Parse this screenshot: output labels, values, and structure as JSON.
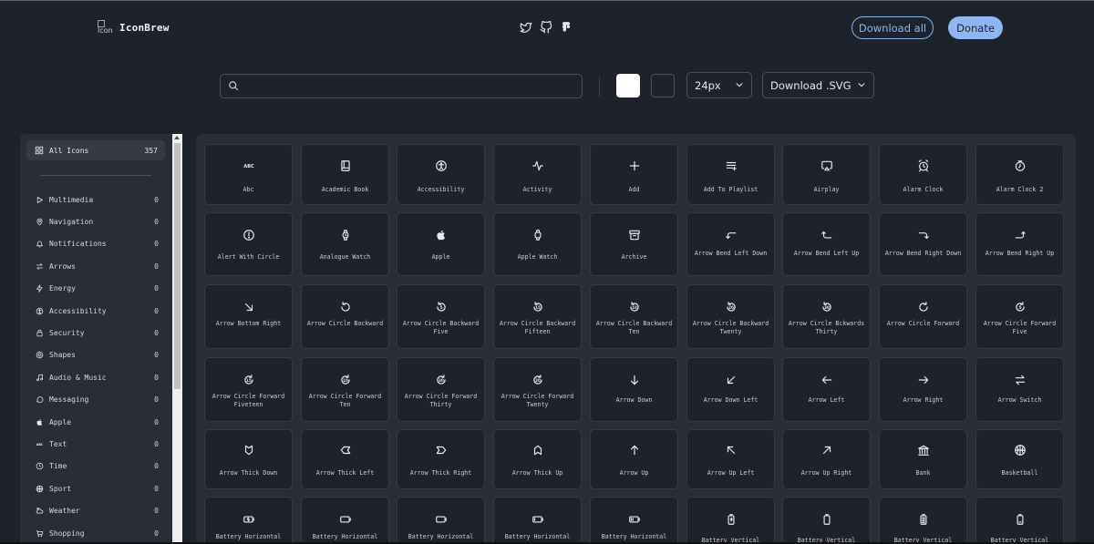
{
  "header": {
    "logo_alt": "Icon",
    "brand": "IconBrew",
    "social": [
      "twitter-icon",
      "github-icon",
      "figma-icon"
    ],
    "download_all_label": "Download all",
    "donate_label": "Donate"
  },
  "toolbar": {
    "search_value": "",
    "color_primary": "#ffffff",
    "color_secondary": "#1e222b",
    "size_label": "24px",
    "format_label": "Download .SVG"
  },
  "sidebar": {
    "all": {
      "label": "All Icons",
      "count": "357",
      "icon": "grid-icon"
    },
    "categories": [
      {
        "label": "Multimedia",
        "count": "0",
        "icon": "play-icon"
      },
      {
        "label": "Navigation",
        "count": "0",
        "icon": "map-pin-icon"
      },
      {
        "label": "Notifications",
        "count": "0",
        "icon": "bell-icon"
      },
      {
        "label": "Arrows",
        "count": "0",
        "icon": "arrows-switch-icon"
      },
      {
        "label": "Energy",
        "count": "0",
        "icon": "lightning-icon"
      },
      {
        "label": "Accessibility",
        "count": "0",
        "icon": "accessibility-icon"
      },
      {
        "label": "Security",
        "count": "0",
        "icon": "lock-icon"
      },
      {
        "label": "Shapes",
        "count": "0",
        "icon": "shapes-icon"
      },
      {
        "label": "Audio & Music",
        "count": "0",
        "icon": "music-note-icon"
      },
      {
        "label": "Messaging",
        "count": "0",
        "icon": "chat-bubble-icon"
      },
      {
        "label": "Apple",
        "count": "0",
        "icon": "apple-icon"
      },
      {
        "label": "Text",
        "count": "0",
        "icon": "abc-icon"
      },
      {
        "label": "Time",
        "count": "0",
        "icon": "clock-icon"
      },
      {
        "label": "Sport",
        "count": "0",
        "icon": "basketball-icon"
      },
      {
        "label": "Weather",
        "count": "0",
        "icon": "cloud-sun-icon"
      },
      {
        "label": "Shopping",
        "count": "0",
        "icon": "cart-icon"
      }
    ]
  },
  "icons": [
    {
      "label": "Abc",
      "icon": "abc-icon"
    },
    {
      "label": "Academic Book",
      "icon": "book-icon"
    },
    {
      "label": "Accessibility",
      "icon": "accessibility-icon"
    },
    {
      "label": "Activity",
      "icon": "activity-icon"
    },
    {
      "label": "Add",
      "icon": "plus-icon"
    },
    {
      "label": "Add To Playlist",
      "icon": "playlist-add-icon"
    },
    {
      "label": "Airplay",
      "icon": "airplay-icon"
    },
    {
      "label": "Alarm Clock",
      "icon": "alarm-clock-icon"
    },
    {
      "label": "Alarm Clock 2",
      "icon": "alarm-clock-2-icon"
    },
    {
      "label": "Alert With Circle",
      "icon": "alert-circle-icon"
    },
    {
      "label": "Analogue Watch",
      "icon": "watch-icon"
    },
    {
      "label": "Apple",
      "icon": "apple-icon"
    },
    {
      "label": "Apple Watch",
      "icon": "apple-watch-icon"
    },
    {
      "label": "Archive",
      "icon": "archive-icon"
    },
    {
      "label": "Arrow Bend Left Down",
      "icon": "arrow-bend-left-down-icon"
    },
    {
      "label": "Arrow Bend Left Up",
      "icon": "arrow-bend-left-up-icon"
    },
    {
      "label": "Arrow Bend Right Down",
      "icon": "arrow-bend-right-down-icon"
    },
    {
      "label": "Arrow Bend Right Up",
      "icon": "arrow-bend-right-up-icon"
    },
    {
      "label": "Arrow Bottom Right",
      "icon": "arrow-bottom-right-icon"
    },
    {
      "label": "Arrow Circle Backward",
      "icon": "arrow-circle-backward-icon"
    },
    {
      "label": "Arrow Circle Backward Five",
      "icon": "arrow-circle-backward-five-icon"
    },
    {
      "label": "Arrow Circle Backward Fifteen",
      "icon": "arrow-circle-backward-fifteen-icon"
    },
    {
      "label": "Arrow Circle Backward Ten",
      "icon": "arrow-circle-backward-ten-icon"
    },
    {
      "label": "Arrow Circle Backward Twenty",
      "icon": "arrow-circle-backward-twenty-icon"
    },
    {
      "label": "Arrow Circle Bckwards Thirty",
      "icon": "arrow-circle-backwards-thirty-icon"
    },
    {
      "label": "Arrow Circle Forward",
      "icon": "arrow-circle-forward-icon"
    },
    {
      "label": "Arrow Circle Forward Five",
      "icon": "arrow-circle-forward-five-icon"
    },
    {
      "label": "Arrow Circle Forward Fiveteen",
      "icon": "arrow-circle-forward-fifteen-icon"
    },
    {
      "label": "Arrow Circle Forward Ten",
      "icon": "arrow-circle-forward-ten-icon"
    },
    {
      "label": "Arrow Circle Forward Thirty",
      "icon": "arrow-circle-forward-thirty-icon"
    },
    {
      "label": "Arrow Circle Forward Twenty",
      "icon": "arrow-circle-forward-twenty-icon"
    },
    {
      "label": "Arrow Down",
      "icon": "arrow-down-icon"
    },
    {
      "label": "Arrow Down Left",
      "icon": "arrow-down-left-icon"
    },
    {
      "label": "Arrow Left",
      "icon": "arrow-left-icon"
    },
    {
      "label": "Arrow Right",
      "icon": "arrow-right-icon"
    },
    {
      "label": "Arrow Switch",
      "icon": "arrow-switch-icon"
    },
    {
      "label": "Arrow Thick Down",
      "icon": "arrow-thick-down-icon"
    },
    {
      "label": "Arrow Thick Left",
      "icon": "arrow-thick-left-icon"
    },
    {
      "label": "Arrow Thick Right",
      "icon": "arrow-thick-right-icon"
    },
    {
      "label": "Arrow Thick Up",
      "icon": "arrow-thick-up-icon"
    },
    {
      "label": "Arrow Up",
      "icon": "arrow-up-icon"
    },
    {
      "label": "Arrow Up Left",
      "icon": "arrow-up-left-icon"
    },
    {
      "label": "Arrow Up Right",
      "icon": "arrow-up-right-icon"
    },
    {
      "label": "Bank",
      "icon": "bank-icon"
    },
    {
      "label": "Basketball",
      "icon": "basketball-icon"
    },
    {
      "label": "Battery Horizontal",
      "icon": "battery-horizontal-charging-icon"
    },
    {
      "label": "Battery Horizontal",
      "icon": "battery-horizontal-empty-icon"
    },
    {
      "label": "Battery Horizontal",
      "icon": "battery-horizontal-icon"
    },
    {
      "label": "Battery Horizontal",
      "icon": "battery-horizontal-low-icon"
    },
    {
      "label": "Battery Horizontal",
      "icon": "battery-horizontal-half-icon"
    },
    {
      "label": "Battery Vertical",
      "icon": "battery-vertical-charging-icon"
    },
    {
      "label": "Battery Vertical",
      "icon": "battery-vertical-empty-icon"
    },
    {
      "label": "Battery Vertical",
      "icon": "battery-vertical-full-icon"
    },
    {
      "label": "Battery Vertical",
      "icon": "battery-vertical-low-icon"
    }
  ]
}
